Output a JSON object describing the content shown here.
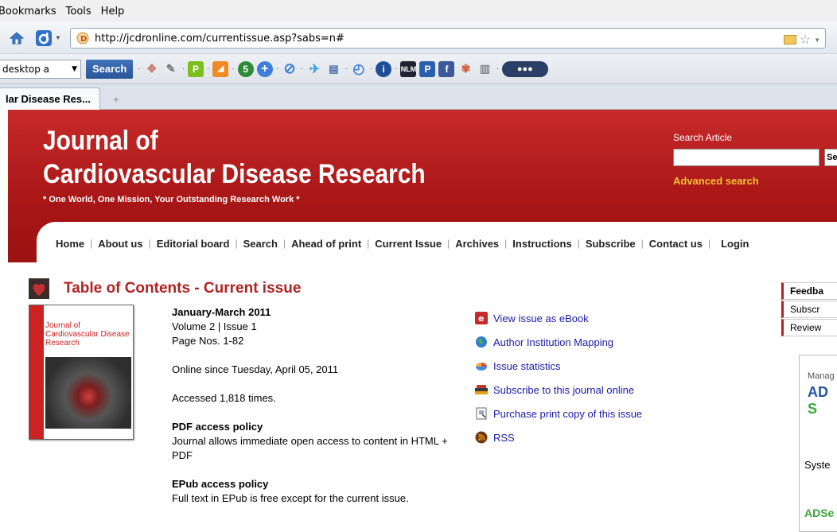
{
  "browser": {
    "menu": [
      "Bookmarks",
      "Tools",
      "Help"
    ],
    "url": "http://jcdronline.com/currentissue.asp?sabs=n#",
    "search_select": "desktop a",
    "search_button": "Search",
    "tab_title": "lar Disease Res..."
  },
  "header": {
    "title_line1": "Journal of",
    "title_line2": "Cardiovascular Disease Research",
    "tagline": "* One World, One Mission, Your Outstanding Research Work *",
    "search_label": "Search Article",
    "search_go": "Se",
    "advanced_search": "Advanced search"
  },
  "nav": [
    "Home",
    "About us",
    "Editorial board",
    "Search",
    "Ahead of print",
    "Current Issue",
    "Archives",
    "Instructions",
    "Subscribe",
    "Contact us",
    "Login"
  ],
  "toc": {
    "heading": "Table of Contents - Current issue",
    "cover_title": "Journal of Cardiovascular Disease Research",
    "issue_period": "January-March 2011",
    "volume": "Volume 2 | Issue 1",
    "pages": "Page Nos. 1-82",
    "online_since": "Online since Tuesday, April 05, 2011",
    "accessed": "Accessed 1,818 times.",
    "pdf_heading": "PDF access policy",
    "pdf_text": "Journal allows immediate open access to content in HTML + PDF",
    "epub_heading": "EPub access policy",
    "epub_text": "Full text in EPub is free except for the current issue."
  },
  "links": [
    {
      "label": "View issue as eBook",
      "icon": "ebook-icon"
    },
    {
      "label": "Author Institution Mapping",
      "icon": "globe-icon"
    },
    {
      "label": "Issue statistics",
      "icon": "statistics-icon"
    },
    {
      "label": "Subscribe to this journal online",
      "icon": "subscribe-icon"
    },
    {
      "label": "Purchase print copy of this issue",
      "icon": "print-icon"
    },
    {
      "label": "RSS",
      "icon": "rss-icon"
    }
  ],
  "sidebar": [
    "Feedba",
    "Subscr",
    "Review"
  ],
  "ad": {
    "line1": "Manag",
    "brand_a": "AD",
    "brand_b": "S",
    "line3": "Syste",
    "line4": "ADSe"
  }
}
